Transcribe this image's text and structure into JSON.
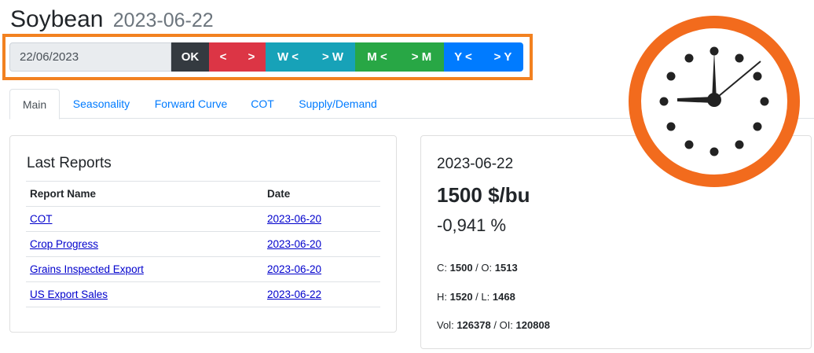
{
  "header": {
    "title": "Soybean",
    "date": "2023-06-22"
  },
  "controls": {
    "date_value": "22/06/2023",
    "ok_label": "OK",
    "day_prev": "<",
    "day_next": ">",
    "week_prev": "W <",
    "week_next": "> W",
    "month_prev": "M <",
    "month_next": "> M",
    "year_prev": "Y <",
    "year_next": "> Y"
  },
  "tabs": [
    {
      "label": "Main",
      "active": true
    },
    {
      "label": "Seasonality"
    },
    {
      "label": "Forward Curve"
    },
    {
      "label": "COT"
    },
    {
      "label": "Supply/Demand"
    }
  ],
  "last_reports": {
    "title": "Last Reports",
    "columns": [
      "Report Name",
      "Date"
    ],
    "rows": [
      {
        "name": "COT",
        "date": "2023-06-20"
      },
      {
        "name": "Crop Progress",
        "date": "2023-06-20"
      },
      {
        "name": "Grains Inspected Export",
        "date": "2023-06-20"
      },
      {
        "name": "US Export Sales",
        "date": "2023-06-22"
      }
    ]
  },
  "quote": {
    "date": "2023-06-22",
    "price": "1500 $/bu",
    "change": "-0,941 %",
    "c_label": "C:",
    "close": "1500",
    "o_label": "O:",
    "open": "1513",
    "h_label": "H:",
    "high": "1520",
    "l_label": "L:",
    "low": "1468",
    "vol_label": "Vol:",
    "volume": "126378",
    "oi_label": "OI:",
    "open_interest": "120808",
    "separator": "/"
  },
  "colors": {
    "highlight_frame": "#f28120",
    "clock_ring": "#f26b1d",
    "ok": "#343a40",
    "day": "#dc3545",
    "week": "#17a2b8",
    "month": "#28a745",
    "year": "#007bff"
  },
  "icons": {
    "clock": "clock-icon"
  }
}
